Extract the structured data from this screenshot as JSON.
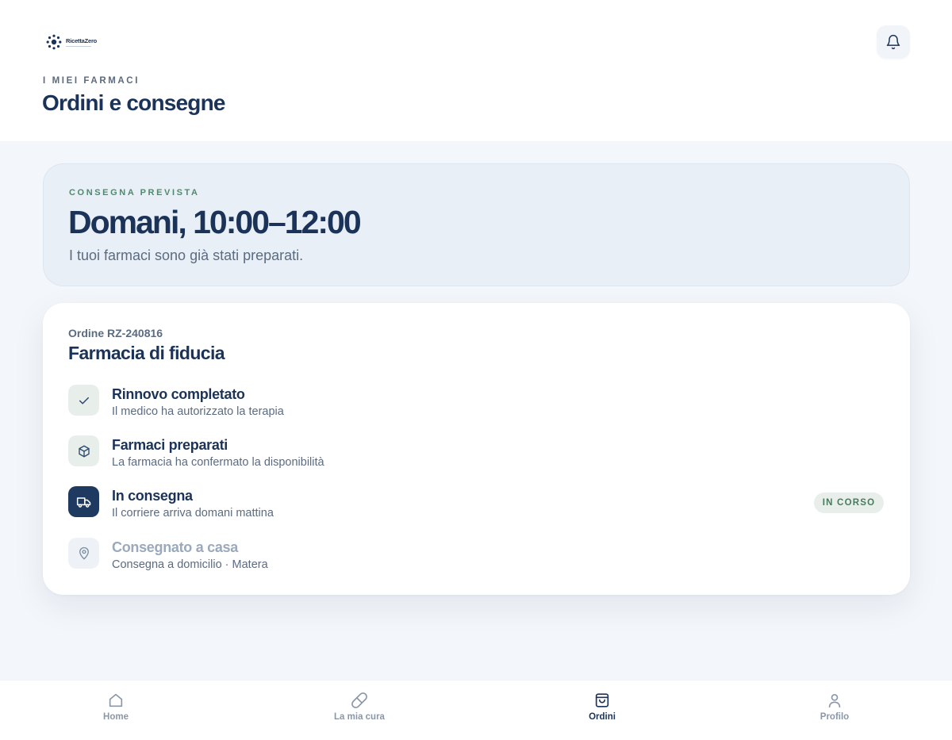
{
  "app": {
    "logo_name": "RicettaZero"
  },
  "header": {
    "eyebrow": "I MIEI FARMACI",
    "title": "Ordini e consegne",
    "notifications_icon": "bell-icon"
  },
  "delivery": {
    "eyebrow": "CONSEGNA PREVISTA",
    "time": "Domani, 10:00–12:00",
    "description": "I tuoi farmaci sono già stati preparati."
  },
  "order": {
    "number": "Ordine RZ-240816",
    "pharmacy": "Farmacia di fiducia",
    "steps": [
      {
        "title": "Rinnovo completato",
        "subtitle": "Il medico ha autorizzato la terapia",
        "icon": "check-icon",
        "state": "done"
      },
      {
        "title": "Farmaci preparati",
        "subtitle": "La farmacia ha confermato la disponibilità",
        "icon": "package-icon",
        "state": "done"
      },
      {
        "title": "In consegna",
        "subtitle": "Il corriere arriva domani mattina",
        "icon": "truck-icon",
        "state": "active",
        "badge": "IN CORSO"
      },
      {
        "title": "Consegnato a casa",
        "subtitle": "Consegna a domicilio · Matera",
        "icon": "map-pin-icon",
        "state": "pending"
      }
    ]
  },
  "nav": {
    "items": [
      {
        "label": "Home",
        "icon": "home-icon",
        "active": false
      },
      {
        "label": "La mia cura",
        "icon": "pill-icon",
        "active": false
      },
      {
        "label": "Ordini",
        "icon": "shopping-bag-icon",
        "active": true
      },
      {
        "label": "Profilo",
        "icon": "user-icon",
        "active": false
      }
    ]
  },
  "colors": {
    "primary": "#1b3358",
    "accent_green": "#4f8a6b",
    "muted_text": "#5b6b80",
    "background": "#f3f6fa"
  }
}
